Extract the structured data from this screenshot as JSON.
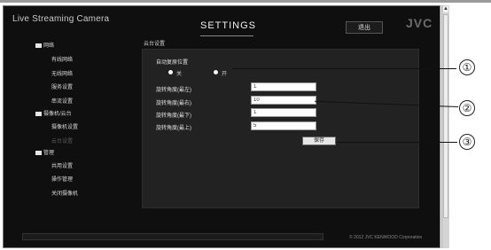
{
  "header": {
    "app_title": "Live Streaming Camera",
    "page_title": "SETTINGS",
    "logout_label": "退出",
    "brand": "JVC"
  },
  "sidebar": {
    "groups": [
      {
        "label": "网络",
        "items": [
          {
            "label": "有线网络"
          },
          {
            "label": "无线网络"
          },
          {
            "label": "服务设置"
          },
          {
            "label": "串流设置"
          }
        ]
      },
      {
        "label": "摄像机/云台",
        "items": [
          {
            "label": "摄像机设置"
          },
          {
            "label": "云台设置"
          }
        ]
      },
      {
        "label": "管理",
        "items": [
          {
            "label": "共用设置"
          },
          {
            "label": "操作管理"
          },
          {
            "label": "关闭摄像机"
          }
        ]
      }
    ]
  },
  "main": {
    "section_title": "云台设置",
    "auto_return_label": "自动复原位置",
    "radio_off": "关",
    "radio_on": "开",
    "selected": "开",
    "fields": [
      {
        "label": "旋转角度(最左)",
        "value": "1"
      },
      {
        "label": "旋转角度(最右)",
        "value": "10"
      },
      {
        "label": "旋转角度(最下)",
        "value": "1"
      },
      {
        "label": "旋转角度(最上)",
        "value": "5"
      }
    ],
    "save_label": "保存"
  },
  "footer": {
    "copyright": "© 2012 JVC KENWOOD Corporation"
  },
  "callouts": [
    "①",
    "②",
    "③"
  ]
}
